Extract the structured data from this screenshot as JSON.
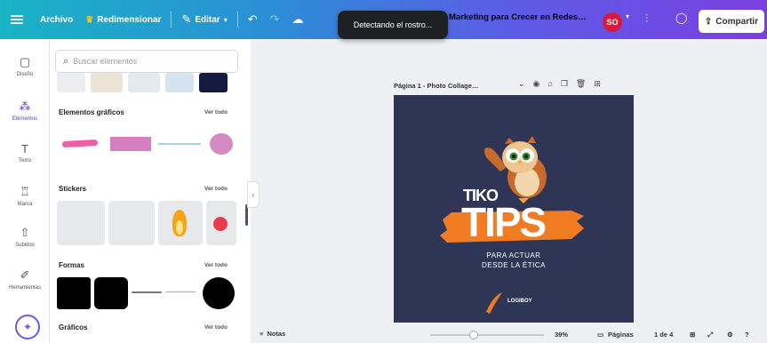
{
  "topbar": {
    "menu_icon": "hamburger-icon",
    "file_label": "Archivo",
    "resize_label": "Redimensionar",
    "edit_label": "Editar",
    "undo_icon": "undo-icon",
    "redo_icon": "redo-icon",
    "cloud_icon": "cloud-save-icon",
    "doc_title": "Marketing para Crecer en Redes…",
    "avatar_initials": "SO",
    "share_label": "Compartir"
  },
  "toast": {
    "text": "Detectando el rostro..."
  },
  "rail": {
    "items": [
      {
        "label": "Diseño",
        "icon": "layout-icon"
      },
      {
        "label": "Elementos",
        "icon": "elements-icon"
      },
      {
        "label": "Texto",
        "icon": "text-icon"
      },
      {
        "label": "Marca",
        "icon": "brand-icon"
      },
      {
        "label": "Subidos",
        "icon": "upload-icon"
      },
      {
        "label": "Herramientas",
        "icon": "draw-icon"
      }
    ],
    "fab_icon": "magic-icon"
  },
  "panel": {
    "search_placeholder": "Buscar elementos",
    "see_all": "Ver todo",
    "sections": [
      {
        "title": "Elementos gráficos"
      },
      {
        "title": "Stickers"
      },
      {
        "title": "Formas"
      },
      {
        "title": "Gráficos"
      }
    ]
  },
  "canvas": {
    "page_label": "Página 1 - Photo Collage…",
    "design": {
      "tiko": "TIKO",
      "tips": "TIPS",
      "line1": "PARA ACTUAR",
      "line2": "DESDE LA ÉTICA",
      "brand": "LOGIBOY"
    }
  },
  "bottombar": {
    "notes_label": "Notas",
    "zoom": "39%",
    "pages_label": "Páginas",
    "page_count": "1 de 4"
  },
  "colors": {
    "design_bg": "#2e3555",
    "accent": "#f07b22",
    "toast_bg": "#1f2024",
    "avatar": "#d81b3c"
  }
}
